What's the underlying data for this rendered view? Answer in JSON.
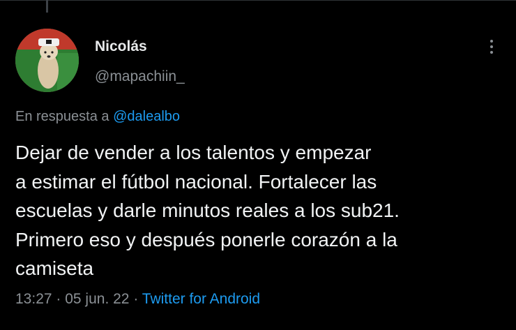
{
  "tweet": {
    "author": {
      "display_name": "Nicolás",
      "handle": "@mapachiin_"
    },
    "reply_prefix": "En respuesta a",
    "reply_to": "@dalealbo",
    "text": "Dejar de vender a los talentos y empezar\na estimar el fútbol nacional. Fortalecer las\nescuelas y darle minutos reales a los sub21.\nPrimero eso y después ponerle corazón a la\ncamiseta",
    "time": "13:27",
    "separator": " · ",
    "date": "05 jun. 22",
    "source": "Twitter for Android"
  },
  "icons": {
    "more": "more-vertical-icon"
  },
  "colors": {
    "background": "#000000",
    "text": "#e7e9ea",
    "secondary_text": "#8b9095",
    "link": "#1d9bf0"
  }
}
